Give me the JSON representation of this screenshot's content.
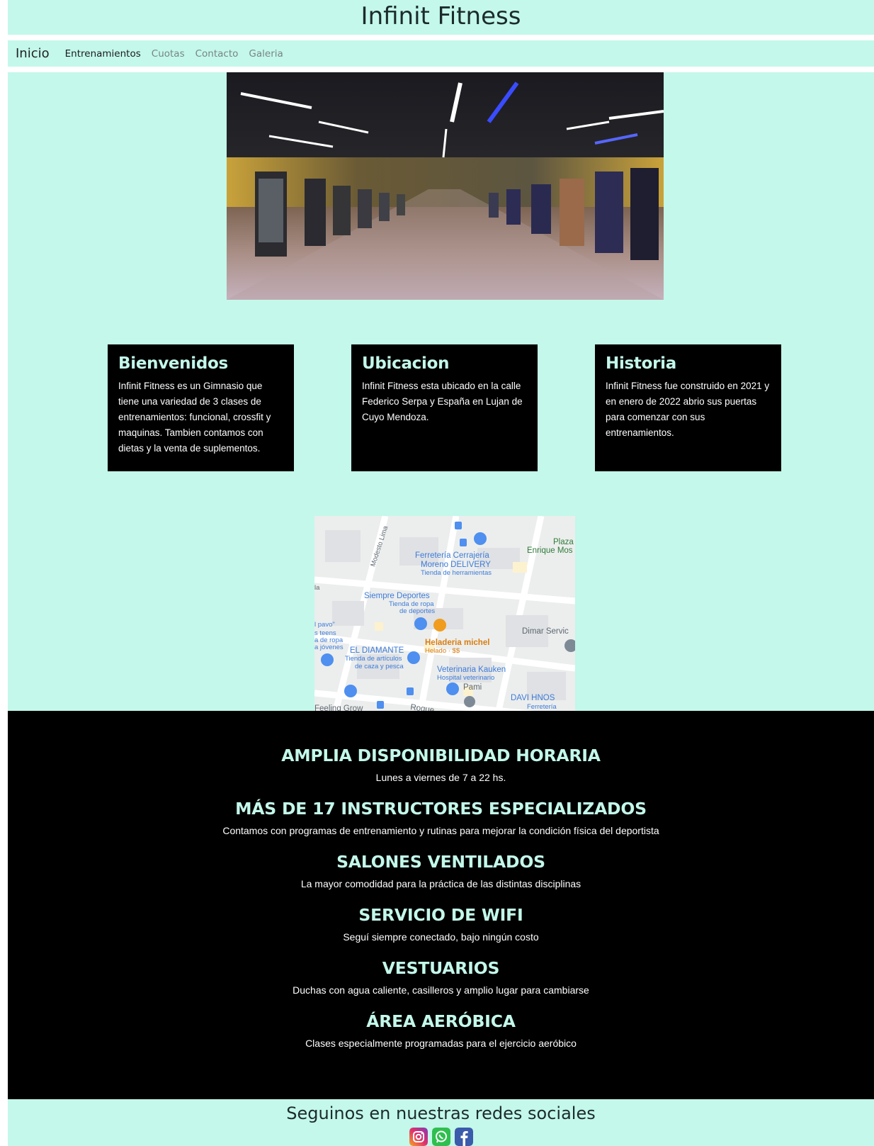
{
  "header": {
    "title": "Infinit Fitness"
  },
  "nav": {
    "brand": "Inicio",
    "links": [
      "Entrenamientos",
      "Cuotas",
      "Contacto",
      "Galeria"
    ]
  },
  "cards": [
    {
      "title": "Bienvenidos",
      "text": "Infinit Fitness es un Gimnasio que tiene una variedad de 3 clases de entrenamientos: funcional, crossfit y maquinas. Tambien contamos con dietas y la venta de suplementos."
    },
    {
      "title": "Ubicacion",
      "text": "Infinit Fitness esta ubicado en la calle Federico Serpa y España en Lujan de Cuyo Mendoza."
    },
    {
      "title": "Historia",
      "text": "Infinit Fitness fue construido en 2021 y en enero de 2022 abrio sus puertas para comenzar con sus entrenamientos."
    }
  ],
  "map": {
    "labels": {
      "plaza": "Plaza",
      "enrique": "Enrique Mos",
      "ferreteria1": "Ferretería Cerrajería",
      "ferreteria2": "Moreno DELIVERY",
      "ferreteria3": "Tienda de herramientas",
      "siempre1": "Siempre Deportes",
      "siempre2": "Tienda de ropa",
      "siempre3": "de deportes",
      "pavo1": "l pavo\"",
      "pavo2": "s teens",
      "pavo3": "a de ropa",
      "pavo4": "a jóvenes",
      "dimar": "Dimar Servic",
      "heladeria1": "Heladeria michel",
      "heladeria2": "Helado · $$",
      "diamante1": "EL DIAMANTE",
      "diamante2": "Tienda de artículos",
      "diamante3": "de caza y pesca",
      "veterinaria1": "Veterinaria Kauken",
      "veterinaria2": "Hospital veterinario",
      "pami": "Pami",
      "davi1": "DAVI HNOS",
      "davi2": "Ferretería",
      "modesto": "Modesto Lima",
      "feeling": "Feeling Grow",
      "roque": "Roque",
      "la": "la"
    }
  },
  "features": [
    {
      "title": "AMPLIA DISPONIBILIDAD HORARIA",
      "text": "Lunes a viernes de 7 a 22 hs."
    },
    {
      "title": "MÁS DE 17 INSTRUCTORES ESPECIALIZADOS",
      "text": "Contamos con programas de entrenamiento y rutinas para mejorar la condición física del deportista"
    },
    {
      "title": "SALONES VENTILADOS",
      "text": "La mayor comodidad para la práctica de las distintas disciplinas"
    },
    {
      "title": "SERVICIO DE WIFI",
      "text": "Seguí siempre conectado, bajo ningún costo"
    },
    {
      "title": "VESTUARIOS",
      "text": "Duchas con agua caliente, casilleros y amplio lugar para cambiarse"
    },
    {
      "title": "ÁREA AERÓBICA",
      "text": "Clases especialmente programadas para el ejercicio aeróbico"
    }
  ],
  "social": {
    "title": "Seguinos en nuestras redes sociales",
    "icons": [
      "instagram-icon",
      "whatsapp-icon",
      "facebook-icon"
    ]
  },
  "colors": {
    "mint": "#c3f8ea",
    "black": "#000000",
    "text_dark": "#1c2b2d"
  }
}
